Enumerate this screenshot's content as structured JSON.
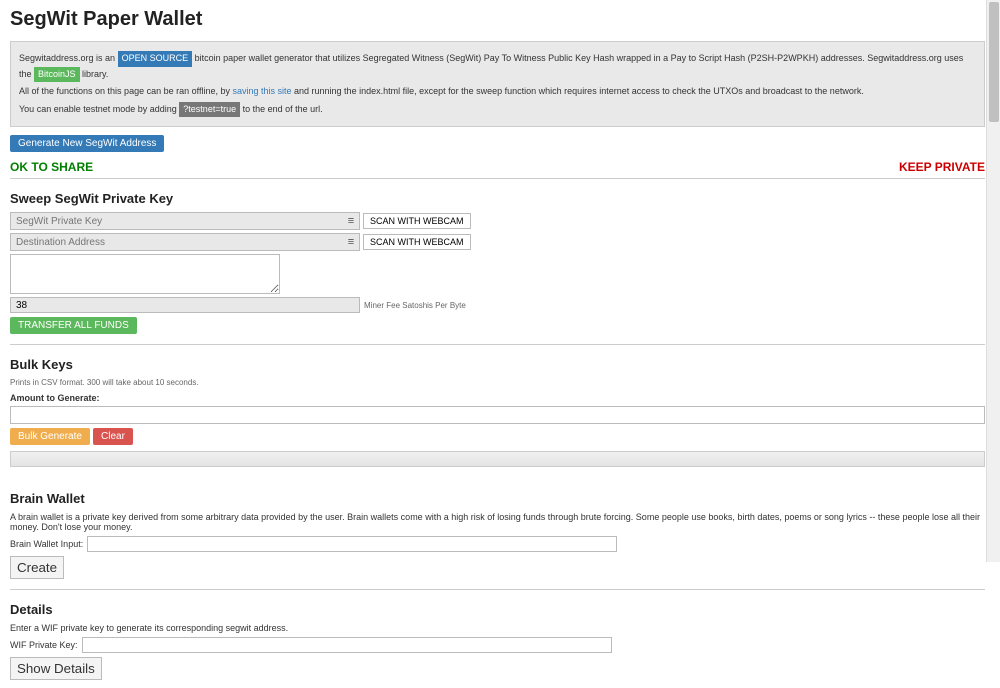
{
  "title": "SegWit Paper Wallet",
  "info": {
    "line1_a": "Segwitaddress.org is an ",
    "line1_badge1": "OPEN SOURCE",
    "line1_b": " bitcoin paper wallet generator that utilizes Segregated Witness (SegWit) Pay To Witness Public Key Hash wrapped in a Pay to Script Hash (P2SH-P2WPKH) addresses. Segwitaddress.org uses the ",
    "line1_badge2": "BitcoinJS",
    "line1_c": " library.",
    "line2_a": "All of the functions on this page can be ran offline, by ",
    "line2_link": "saving this site",
    "line2_b": " and running the index.html file, except for the sweep function which requires internet access to check the UTXOs and broadcast to the network.",
    "line3_a": "You can enable testnet mode by adding ",
    "line3_badge": "?testnet=true",
    "line3_b": " to the end of the url."
  },
  "generate_btn": "Generate New SegWit Address",
  "ok_share": "OK TO SHARE",
  "keep_private": "KEEP PRIVATE",
  "sweep": {
    "heading": "Sweep SegWit Private Key",
    "privkey_placeholder": "SegWit Private Key",
    "dest_placeholder": "Destination Address",
    "scan_label": "SCAN WITH WEBCAM",
    "fee_value": "38",
    "fee_label": "Miner Fee Satoshis Per Byte",
    "transfer_btn": "TRANSFER ALL FUNDS"
  },
  "bulk": {
    "heading": "Bulk Keys",
    "note": "Prints in CSV format. 300 will take about 10 seconds.",
    "amount_label": "Amount to Generate:",
    "generate_btn": "Bulk Generate",
    "clear_btn": "Clear"
  },
  "brain": {
    "heading": "Brain Wallet",
    "desc": "A brain wallet is a private key derived from some arbitrary data provided by the user. Brain wallets come with a high risk of losing funds through brute forcing. Some people use books, birth dates, poems or song lyrics -- these people lose all their money. Don't lose your money.",
    "input_label": "Brain Wallet Input:",
    "create_btn": "Create"
  },
  "details": {
    "heading": "Details",
    "desc": "Enter a WIF private key to generate its corresponding segwit address.",
    "input_label": "WIF Private Key:",
    "show_btn": "Show Details"
  }
}
